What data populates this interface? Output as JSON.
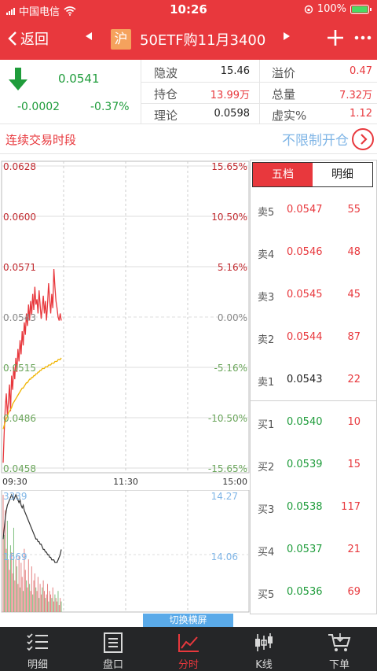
{
  "status": {
    "carrier": "中国电信",
    "time": "10:26",
    "battery": "100%"
  },
  "nav": {
    "back": "返回",
    "market": "沪",
    "title": "50ETF购11月3400"
  },
  "quote": {
    "price": "0.0541",
    "change": "-0.0002",
    "change_pct": "-0.37%",
    "cells": [
      {
        "label": "隐波",
        "value": "15.46",
        "color": "#222"
      },
      {
        "label": "持仓",
        "value": "13.99万",
        "color": "#e8383d"
      },
      {
        "label": "理论",
        "value": "0.0598",
        "color": "#222"
      },
      {
        "label": "溢价",
        "value": "0.47",
        "color": "#e8383d"
      },
      {
        "label": "总量",
        "value": "7.32万",
        "color": "#e8383d"
      },
      {
        "label": "虚实%",
        "value": "1.12",
        "color": "#e8383d"
      }
    ]
  },
  "session": {
    "label": "连续交易时段",
    "unlimited": "不限制开仓"
  },
  "chart": {
    "price_labels": [
      "0.0628",
      "0.0600",
      "0.0571",
      "0.0543",
      "0.0515",
      "0.0486",
      "0.0458"
    ],
    "pct_labels": [
      "15.65%",
      "10.50%",
      "5.16%",
      "0.00%",
      "-5.16%",
      "-10.50%",
      "-15.65%"
    ],
    "times": [
      "09:30",
      "11:30",
      "15:00"
    ],
    "vol_labels": [
      "3339",
      "14.27",
      "1669",
      "14.06"
    ]
  },
  "chart_data": {
    "type": "line",
    "title": "",
    "xlabel": "",
    "ylabel": "",
    "ylim": [
      0.0458,
      0.0628
    ],
    "x": [
      0,
      1,
      2,
      3,
      4,
      5,
      6,
      7,
      8,
      9,
      10,
      11,
      12,
      13,
      14,
      15,
      16,
      17,
      18,
      19,
      20,
      21,
      22,
      23,
      24,
      25,
      26,
      27,
      28,
      29,
      30,
      31,
      32,
      33,
      34,
      35,
      36,
      37,
      38,
      39,
      40,
      41,
      42,
      43,
      44,
      45,
      46,
      47,
      48,
      49,
      50,
      51,
      52,
      53,
      54,
      55
    ],
    "series": [
      {
        "values": [
          0.0461,
          0.0478,
          0.0492,
          0.05,
          0.0488,
          0.0495,
          0.0505,
          0.049,
          0.051,
          0.0502,
          0.0515,
          0.0508,
          0.052,
          0.0512,
          0.0525,
          0.0518,
          0.053,
          0.0522,
          0.0535,
          0.0527,
          0.054,
          0.0533,
          0.0545,
          0.0538,
          0.055,
          0.0541,
          0.0552,
          0.0544,
          0.0556,
          0.0547,
          0.056,
          0.055,
          0.0553,
          0.0545,
          0.0558,
          0.055,
          0.0542,
          0.0548,
          0.0555,
          0.0545,
          0.0552,
          0.0541,
          0.055,
          0.0562,
          0.0553,
          0.0545,
          0.0556,
          0.0548,
          0.057,
          0.056,
          0.0552,
          0.0548,
          0.0543,
          0.0541,
          0.0545,
          0.0541
        ]
      },
      {
        "values": [
          0.048,
          0.0482,
          0.0484,
          0.0486,
          0.0487,
          0.0489,
          0.049,
          0.0491,
          0.0492,
          0.0494,
          0.0495,
          0.0496,
          0.0497,
          0.0498,
          0.0499,
          0.05,
          0.0501,
          0.0502,
          0.0503,
          0.0503,
          0.0504,
          0.0505,
          0.0506,
          0.0506,
          0.0507,
          0.0508,
          0.0508,
          0.0509,
          0.0509,
          0.051,
          0.051,
          0.0511,
          0.0511,
          0.0512,
          0.0512,
          0.0513,
          0.0513,
          0.0514,
          0.0514,
          0.0514,
          0.0515,
          0.0515,
          0.0515,
          0.0516,
          0.0516,
          0.0516,
          0.0517,
          0.0517,
          0.0517,
          0.0518,
          0.0518,
          0.0518,
          0.0519,
          0.0519,
          0.0519,
          0.052
        ]
      }
    ],
    "volume_series": {
      "values": [
        3339,
        2200,
        2900,
        1800,
        2600,
        1500,
        1200,
        1900,
        1700,
        1100,
        2400,
        900,
        1500,
        1300,
        800,
        1600,
        700,
        1400,
        1000,
        600,
        1800,
        1200,
        900,
        700,
        1500,
        800,
        600,
        1300,
        500,
        900,
        1100,
        700,
        600,
        1000,
        400,
        800,
        500,
        700,
        900,
        600,
        400,
        500,
        800,
        300,
        600,
        500,
        400,
        700,
        300,
        500,
        400,
        300,
        600,
        200,
        400,
        300
      ]
    },
    "position_series": {
      "values": [
        14.1,
        14.14,
        14.18,
        14.21,
        14.23,
        14.24,
        14.25,
        14.26,
        14.27,
        14.26,
        14.25,
        14.26,
        14.27,
        14.26,
        14.25,
        14.24,
        14.25,
        14.23,
        14.22,
        14.23,
        14.21,
        14.2,
        14.19,
        14.18,
        14.17,
        14.16,
        14.15,
        14.14,
        14.13,
        14.12,
        14.11,
        14.1,
        14.1,
        14.09,
        14.09,
        14.08,
        14.08,
        14.07,
        14.06,
        14.06,
        14.05,
        14.05,
        14.04,
        14.04,
        14.03,
        14.03,
        14.02,
        14.02,
        14.02,
        14.01,
        14.01,
        14.01,
        14.02,
        14.03,
        14.04,
        14.06
      ]
    },
    "times": [
      "09:30",
      "11:30",
      "15:00"
    ]
  },
  "orderbook": {
    "tabs": [
      "五档",
      "明细"
    ],
    "asks": [
      {
        "name": "卖5",
        "price": "0.0547",
        "vol": "55",
        "pcolor": "#e8383d"
      },
      {
        "name": "卖4",
        "price": "0.0546",
        "vol": "48",
        "pcolor": "#e8383d"
      },
      {
        "name": "卖3",
        "price": "0.0545",
        "vol": "45",
        "pcolor": "#e8383d"
      },
      {
        "name": "卖2",
        "price": "0.0544",
        "vol": "87",
        "pcolor": "#e8383d"
      },
      {
        "name": "卖1",
        "price": "0.0543",
        "vol": "22",
        "pcolor": "#222"
      }
    ],
    "bids": [
      {
        "name": "买1",
        "price": "0.0540",
        "vol": "10",
        "pcolor": "#1f9c3b"
      },
      {
        "name": "买2",
        "price": "0.0539",
        "vol": "15",
        "pcolor": "#1f9c3b"
      },
      {
        "name": "买3",
        "price": "0.0538",
        "vol": "117",
        "pcolor": "#1f9c3b"
      },
      {
        "name": "买4",
        "price": "0.0537",
        "vol": "21",
        "pcolor": "#1f9c3b"
      },
      {
        "name": "买5",
        "price": "0.0536",
        "vol": "69",
        "pcolor": "#1f9c3b"
      }
    ]
  },
  "switch_label": "切换横屏",
  "tabbar": [
    {
      "label": "明细",
      "icon": "list-check-icon"
    },
    {
      "label": "盘口",
      "icon": "orderbook-icon"
    },
    {
      "label": "分时",
      "icon": "timeshare-icon"
    },
    {
      "label": "K线",
      "icon": "candlestick-icon"
    },
    {
      "label": "下单",
      "icon": "cart-icon"
    }
  ],
  "colors": {
    "red": "#e8383d",
    "green": "#1f9c3b",
    "avg_line": "#f0b400",
    "blue": "#5aaae9"
  }
}
